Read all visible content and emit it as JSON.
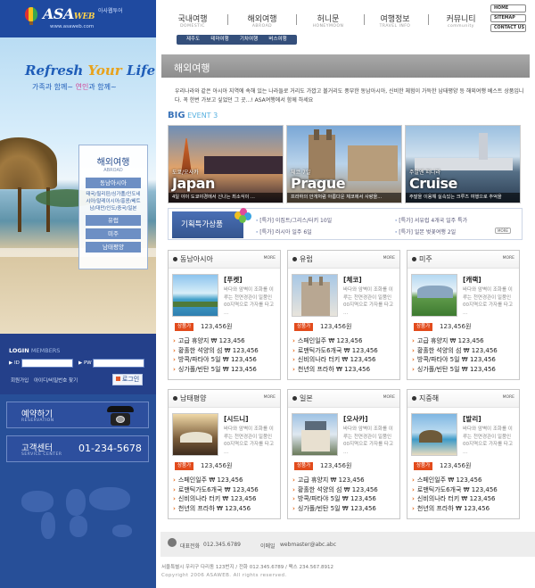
{
  "brand": {
    "logo": "ASA",
    "logo_suffix": "WEB",
    "logo_korean": "아사웹투어",
    "url": "www.asaweb.com"
  },
  "hero": {
    "slogan_a": "Refresh ",
    "slogan_b": "Your ",
    "slogan_c": "Life",
    "sub_a": "가족과 함께~",
    "sub_b": "연인",
    "sub_c": "과 함께~"
  },
  "left_menu": {
    "title": "해외여행",
    "sub": "ABROAD",
    "items": [
      "동남아시아",
      "유럽",
      "미주",
      "남태평양"
    ],
    "desc": "태국/필리핀/싱가폴/인도네시아/말레이시아/홍콩/베트남/대만/인도/중국/일본"
  },
  "login": {
    "title": "LOGIN",
    "title_sub": "MEMBERS",
    "id_label": "▶ ID",
    "pw_label": "▶ PW",
    "join": "회원가입",
    "find": "아이디/비밀번호 찾기",
    "button": "로그인"
  },
  "promo": {
    "reserve_ko": "예약하기",
    "reserve_en": "RESERVATION",
    "service_ko": "고객센터",
    "service_en": "SERVICE CENTER",
    "phone": "01-234-5678"
  },
  "nav": [
    {
      "ko": "국내여행",
      "en": "DOMESTIC"
    },
    {
      "ko": "해외여행",
      "en": "ABROAD"
    },
    {
      "ko": "허니문",
      "en": "HONEYMOON"
    },
    {
      "ko": "여행정보",
      "en": "TRAVEL INFO"
    },
    {
      "ko": "커뮤니티",
      "en": "community"
    }
  ],
  "util": [
    "HOME",
    "SITEMAP",
    "CONTACT US"
  ],
  "sub_tabs": [
    "제주도",
    "테마여행",
    "기차여행",
    "버스여행"
  ],
  "section_title": "해외여행",
  "intro": "우리나라와 같은 아시아 지역에 속해 있는 나라들로 거리도 가깝고 볼거리도 풍부한 동남아시아, 신비한 체험이 가득한 남태평양 등 해외여행 베스트 상품입니다. 꼭 한번 가보고 싶었던 그 곳...! ASA여행에서 함께 하세요",
  "big_event": {
    "a": "BIG",
    "b": " EVENT 3"
  },
  "banners": [
    {
      "cap": "도쿄/오사카",
      "big": "Japan",
      "desc": "4일 야이 도쿄야경에서 신나는 최소식이 ..."
    },
    {
      "cap": "체코 7일",
      "big": "Prague",
      "desc": "프라하의 안개처럼 아름다운 체코에서 사랑을..."
    },
    {
      "cap": "주말엔 떠나라",
      "big": "Cruise",
      "desc": "주말을 이용해 실속있는 크루즈 여행으로 추억을"
    }
  ],
  "special": {
    "title": "기획특가상품",
    "items": [
      "[특가] 이집트/그리스/터키 10일",
      "[특가] 러시아 일주 6일",
      "[특가] 서유럽 4개국 일주 특가",
      "[특가] 일본 벚꽃여행 2일"
    ],
    "more": "MORE"
  },
  "cards": [
    {
      "title": "동남아시아",
      "more": "MORE",
      "name": "[푸켓]",
      "desc": "바다와 암벽이 조화를 이루는 천연경관이 일품인 00지역으로 가자를 타고 ...",
      "badge": "상품가",
      "price": "123,456원",
      "list": [
        "고급 휴양지 ₩ 123,456",
        "황홀한 석양의 섬 ₩ 123,456",
        "방콕/파타야 5일 ₩ 123,456",
        "싱가폴/빈탄 5일 ₩ 123,456"
      ]
    },
    {
      "title": "유럽",
      "more": "MORE",
      "name": "[체코]",
      "desc": "바다와 암벽이 조화를 이루는 천연경관이 일품인 00지역으로 가자를 타고 ...",
      "badge": "상품가",
      "price": "123,456원",
      "list": [
        "스페인일주 ₩ 123,456",
        "로맨틱가도6개국 ₩ 123,456",
        "신비의나라 터키 ₩ 123,456",
        "천년의 프라하 ₩ 123,456"
      ]
    },
    {
      "title": "미주",
      "more": "MORE",
      "name": "[캐랙]",
      "desc": "바다와 암벽이 조화를 이루는 천연경관이 일품인 00지역으로 가자를 타고 ...",
      "badge": "상품가",
      "price": "123,456원",
      "list": [
        "고급 휴양지 ₩ 123,456",
        "황홀한 석양의 섬 ₩ 123,456",
        "방콕/파타야 5일 ₩ 123,456",
        "싱가폴/빈탄 5일 ₩ 123,456"
      ]
    },
    {
      "title": "남태평양",
      "more": "MORE",
      "name": "[시드니]",
      "desc": "바다와 암벽이 조화를 이루는 천연경관이 일품인 00지역으로 가자를 타고 ...",
      "badge": "상품가",
      "price": "123,456원",
      "list": [
        "스페인일주 ₩ 123,456",
        "로맨틱가도6개국 ₩ 123,456",
        "신비의나라 터키 ₩ 123,456",
        "천년의 프라하 ₩ 123,456"
      ]
    },
    {
      "title": "일본",
      "more": "MORE",
      "name": "[오사카]",
      "desc": "바다와 암벽이 조화를 이루는 천연경관이 일품인 00지역으로 가자를 타고 ...",
      "badge": "상품가",
      "price": "123,456원",
      "list": [
        "고급 휴양지 ₩ 123,456",
        "황홀한 석양의 섬 ₩ 123,456",
        "방콕/파타야 5일 ₩ 123,456",
        "싱가폴/빈탄 5일 ₩ 123,456"
      ]
    },
    {
      "title": "지중해",
      "more": "MORE",
      "name": "[발리]",
      "desc": "바다와 암벽이 조화를 이루는 천연경관이 일품인 00지역으로 가자를 타고 ...",
      "badge": "상품가",
      "price": "123,456원",
      "list": [
        "스페인일주 ₩ 123,456",
        "로맨틱가도6개국 ₩ 123,456",
        "신비의나라 터키 ₩ 123,456",
        "천년의 프라하 ₩ 123,456"
      ]
    }
  ],
  "footer": {
    "tel_label": "대표전화",
    "tel": "012.345.6789",
    "mail_label": "이메일",
    "mail": "webmaster@abc.abc",
    "address": "서울특별시 우리구 다리동 123번지 / 전화 012.345.6789 / 팩스 234.567.8912",
    "copy": "Copyright 2006 ASAWEB. All rights reserved."
  }
}
